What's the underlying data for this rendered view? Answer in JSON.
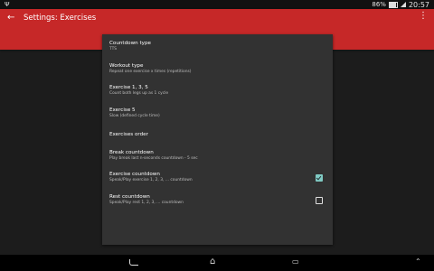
{
  "status_bar": {
    "left_glyph": "Ψ",
    "battery_text": "86%",
    "time": "20:57",
    "battery_level": 0.86
  },
  "app_bar": {
    "title": "Settings: Exercises",
    "color": "#c62828"
  },
  "preferences": [
    {
      "title": "Countdown type",
      "summary": "TTS"
    },
    {
      "title": "Workout type",
      "summary": "Repeat one exercise x times (repetitions)"
    },
    {
      "title": "Exercise 1, 3, 5",
      "summary": "Count both legs up as 1 cycle"
    },
    {
      "title": "Exercise 5",
      "summary": "Slow (defined cycle time)"
    },
    {
      "title": "Exercises order",
      "summary": ""
    },
    {
      "title": "Break countdown",
      "summary": "Play break last n-seconds countdown - 5 sec"
    },
    {
      "title": "Exercise countdown",
      "summary": "Speak/Play exercise 1, 2, 3, ... countdown",
      "checked": true
    },
    {
      "title": "Rest countdown",
      "summary": "Speak/Play rest 1, 2, 3, ... countdown",
      "checked": false
    }
  ],
  "nav_bar": {
    "home_glyph": "⌂",
    "recents_glyph": "▭",
    "up_glyph": "⌃"
  },
  "colors": {
    "card_background": "#323232",
    "checkbox_accent": "#80cbc4"
  }
}
